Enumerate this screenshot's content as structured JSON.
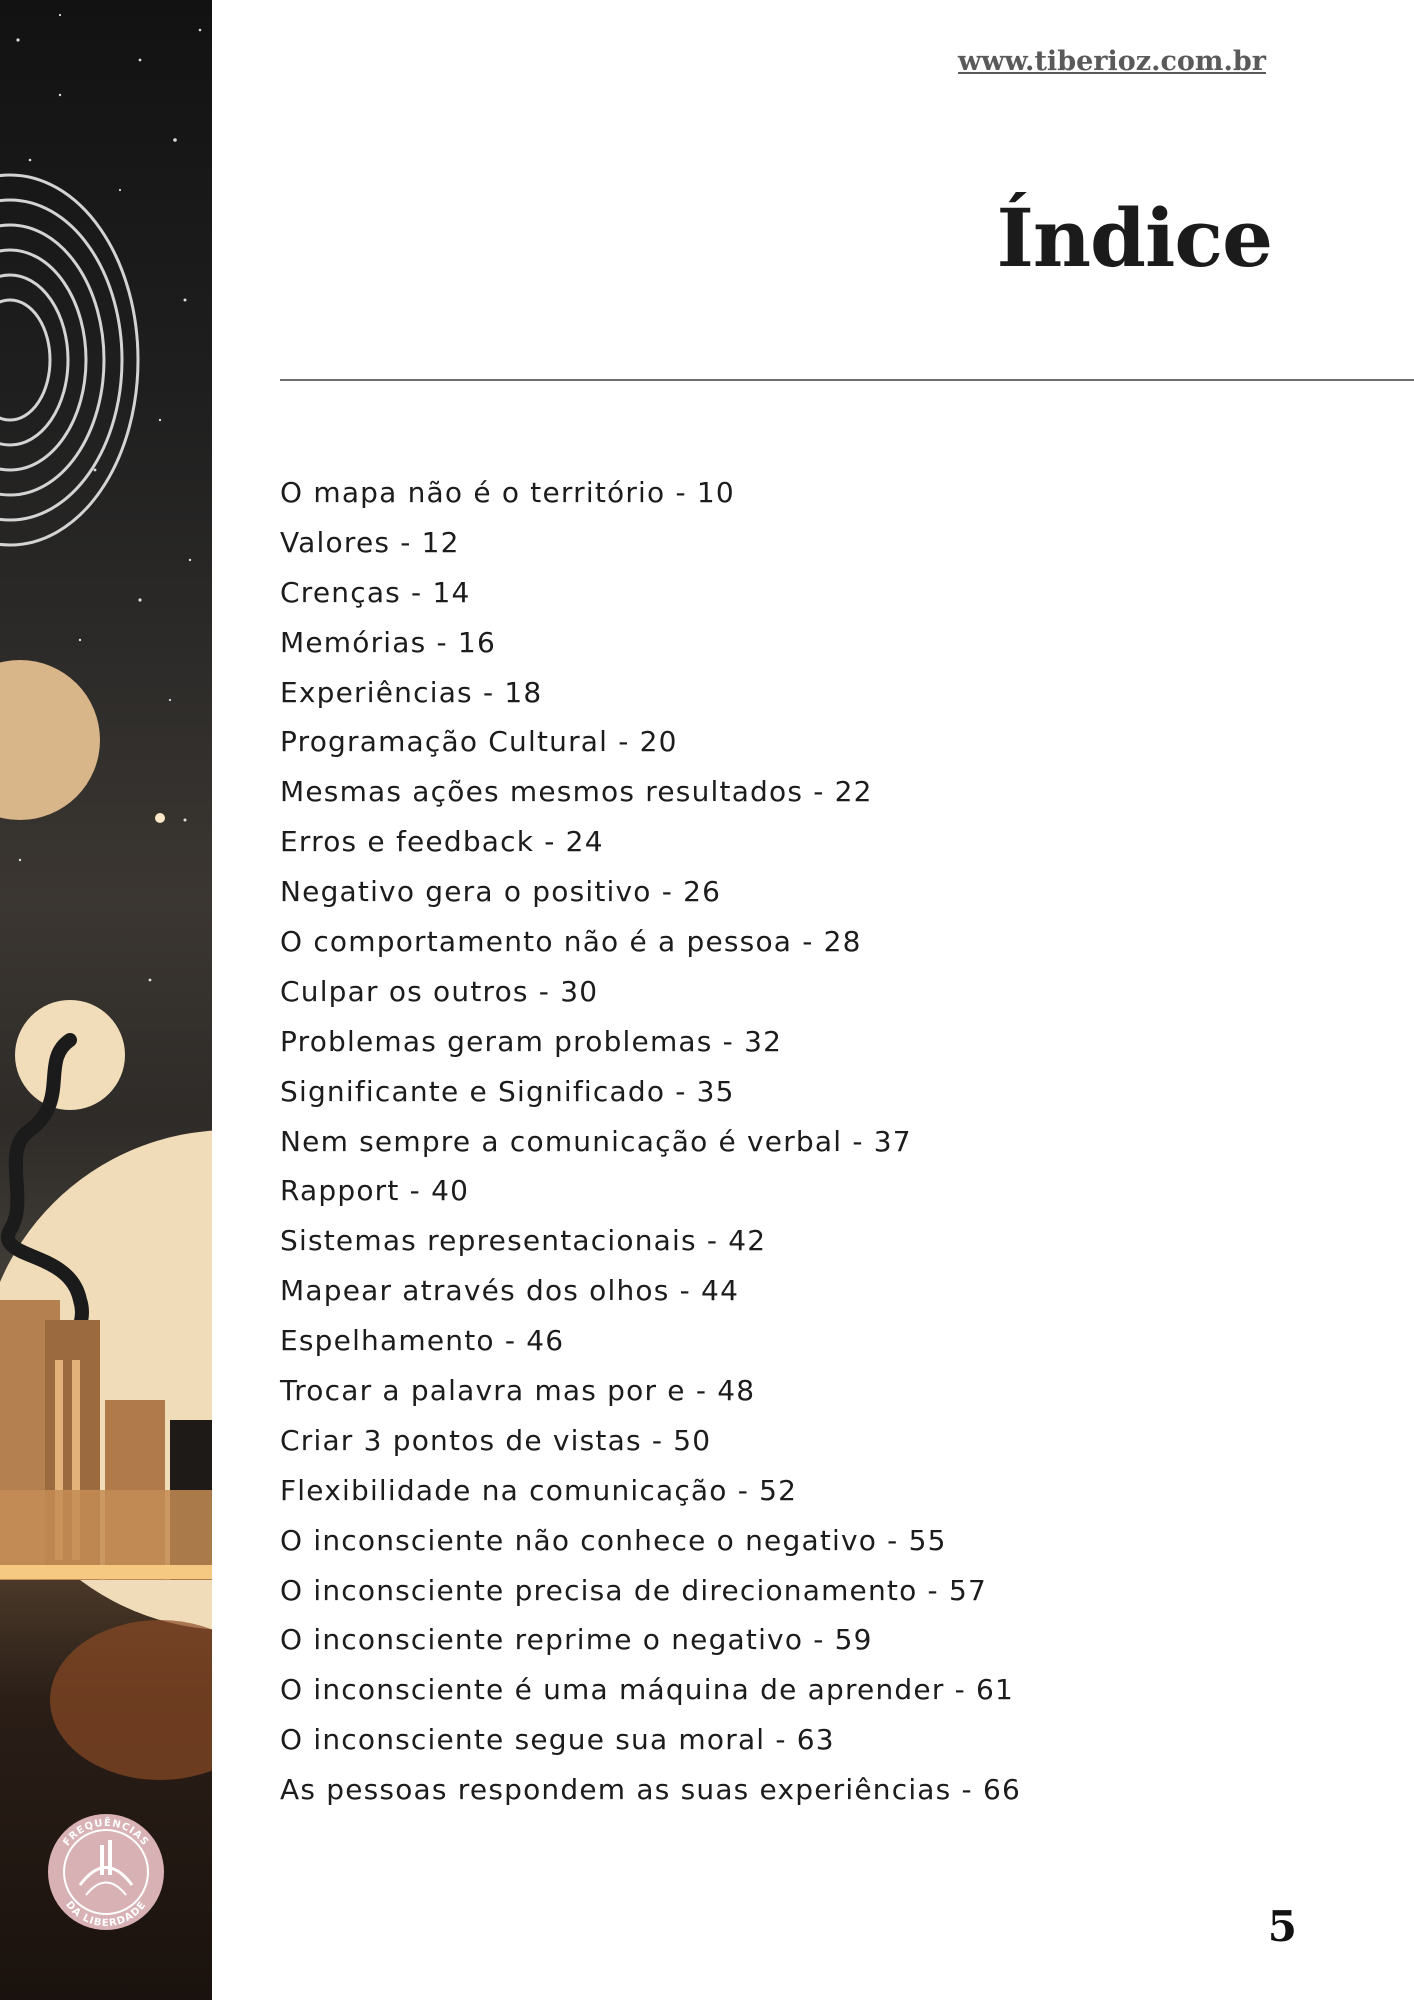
{
  "header": {
    "url": "www.tiberioz.com.br",
    "title": "Índice"
  },
  "toc": {
    "items": [
      "O mapa não é o território - 10",
      "Valores - 12",
      "Crenças - 14",
      "Memórias - 16",
      "Experiências - 18",
      "Programação Cultural - 20",
      "Mesmas ações mesmos resultados - 22",
      "Erros e feedback - 24",
      "Negativo gera o positivo - 26",
      "O comportamento não é a pessoa - 28",
      "Culpar os outros - 30",
      "Problemas geram problemas - 32",
      "Significante e Significado - 35",
      "Nem sempre a comunicação é verbal - 37",
      "Rapport - 40",
      "Sistemas representacionais - 42",
      "Mapear através dos olhos - 44",
      "Espelhamento - 46",
      "Trocar a palavra mas por e - 48",
      "Criar 3 pontos de vistas - 50",
      "Flexibilidade na comunicação - 52",
      "O inconsciente não conhece o negativo - 55",
      "O inconsciente precisa de direcionamento - 57",
      "O inconsciente reprime o negativo - 59",
      "O inconsciente é uma máquina de aprender - 61",
      "O inconsciente segue sua moral - 63",
      "As pessoas respondem as suas experiências - 66"
    ]
  },
  "sidebar": {
    "logo_text_top": "FREQUÊNCIAS",
    "logo_text_bottom": "DA LIBERDADE"
  },
  "footer": {
    "page_number": "5"
  }
}
